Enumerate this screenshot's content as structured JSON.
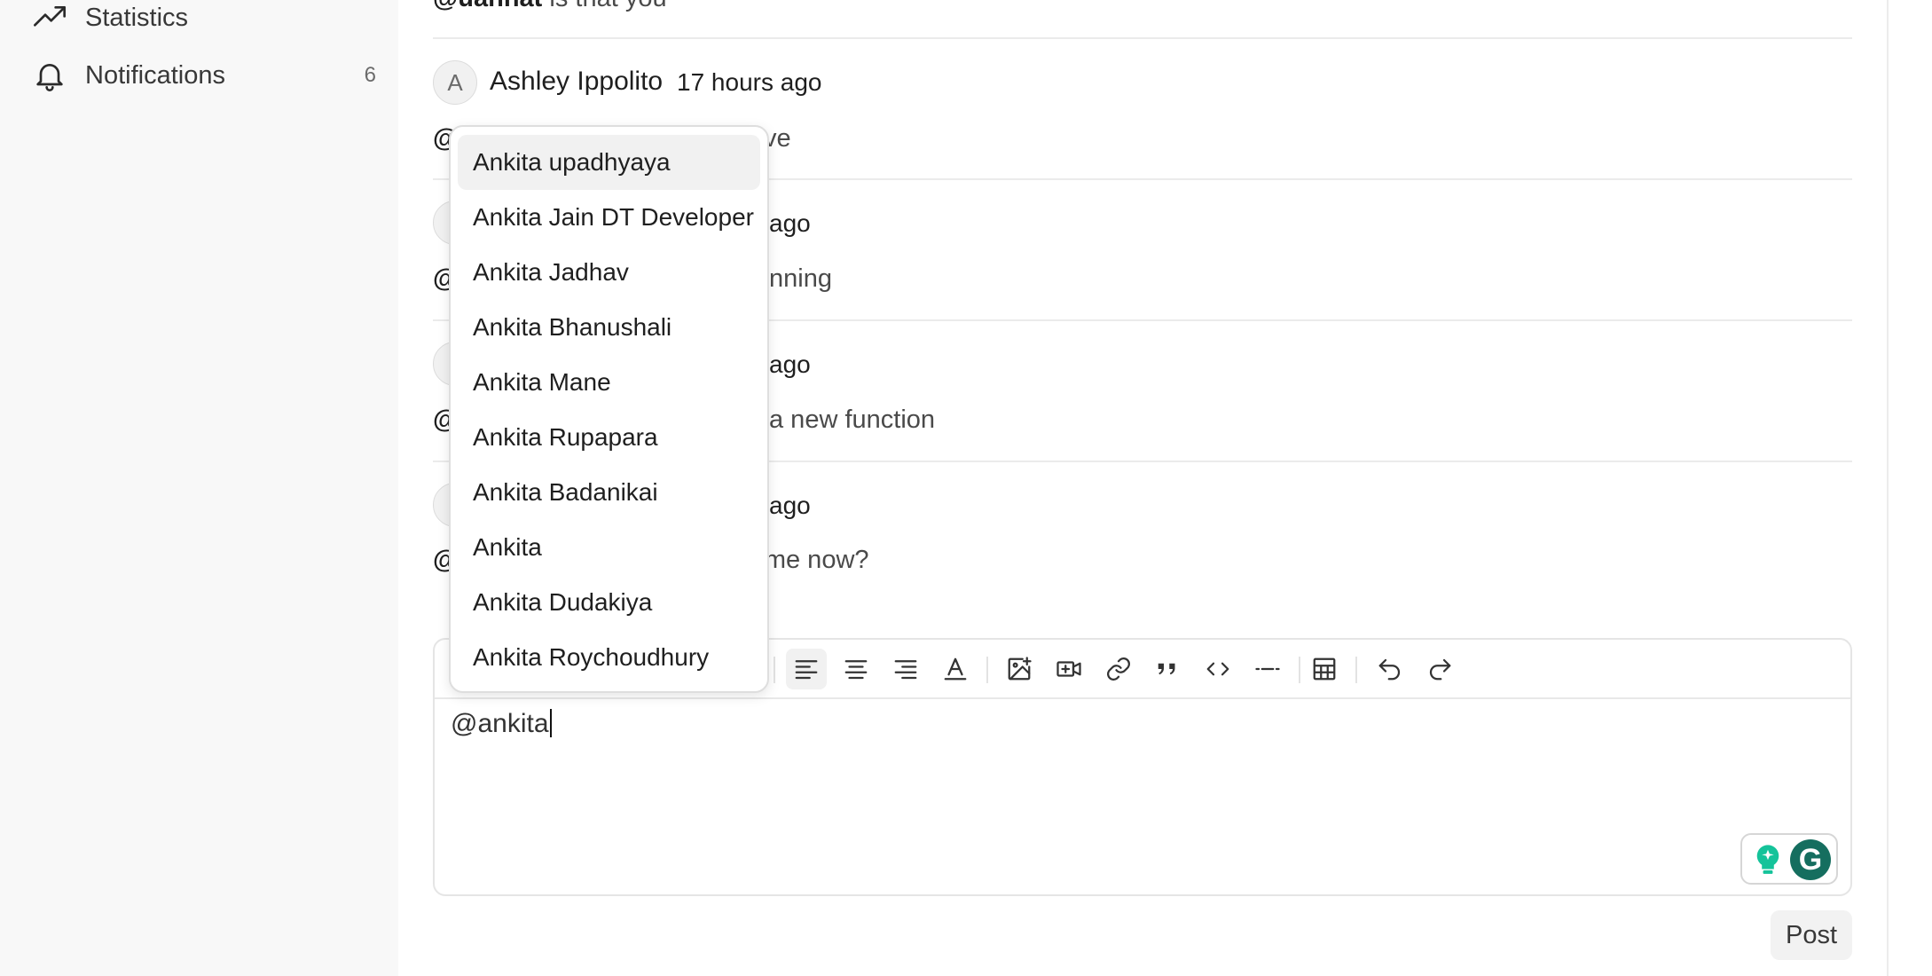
{
  "sidebar": {
    "items": [
      {
        "label": "Statistics",
        "icon": "trending-up-icon",
        "count": ""
      },
      {
        "label": "Notifications",
        "icon": "bell-icon",
        "count": "6"
      }
    ]
  },
  "comments": {
    "top_partial": {
      "mention": "@uannat",
      "text": " is that you"
    },
    "items": [
      {
        "avatar": "A",
        "author": "Ashley Ippolito",
        "time": "17 hours ago",
        "text_visible": "ve"
      },
      {
        "time_visible": "ago",
        "text_visible": "nning"
      },
      {
        "time_visible": "ago",
        "text_visible": "a new function"
      },
      {
        "time_visible": "ago",
        "text_visible": "re me now?"
      }
    ]
  },
  "editor": {
    "value": "@ankita",
    "post_label": "Post"
  },
  "mention_popup": {
    "selected_index": 0,
    "options": [
      "Ankita upadhyaya",
      "Ankita Jain DT Developer",
      "Ankita Jadhav",
      "Ankita Bhanushali",
      "Ankita Mane",
      "Ankita Rupapara",
      "Ankita Badanikai",
      "Ankita",
      "Ankita Dudakiya",
      "Ankita Roychoudhury"
    ]
  },
  "colors": {
    "sidebar_bg": "#f8f8f8",
    "grammarly_green": "#156e5f",
    "grammarly_bulb": "#15c39a"
  }
}
